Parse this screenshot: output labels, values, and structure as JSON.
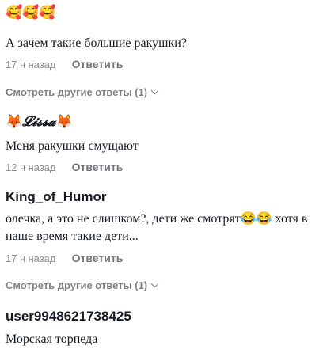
{
  "comments": [
    {
      "author": "🥰🥰🥰",
      "text": "А зачем такие большие ракушки?",
      "time": "17 ч назад",
      "reply_label": "Ответить",
      "more_replies": "Смотреть другие ответы (1)"
    },
    {
      "author_prefix": "🦊",
      "author_name": "𝓛𝓲𝓼𝓼𝓪",
      "author_suffix": "🦊",
      "text": "Меня ракушки смущают",
      "time": "12 ч назад",
      "reply_label": "Ответить"
    },
    {
      "author": "King_of_Humor",
      "text_line1": "олечка, а это не слишком?, дети же смотрят😂😂 хотя в",
      "text_line2": "наше время такие дети...",
      "time": "17 ч назад",
      "reply_label": "Ответить",
      "more_replies": "Смотреть другие ответы (1)"
    },
    {
      "author": "user9948621738425",
      "text": "Морская торпеда"
    }
  ],
  "icons": {
    "chevron": "chevron-down-icon"
  }
}
